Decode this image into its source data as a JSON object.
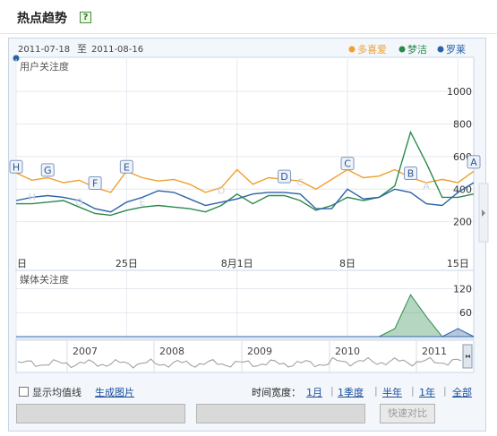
{
  "header": {
    "title": "热点趋势",
    "help_icon": "?"
  },
  "date_range": {
    "start": "2011-07-18",
    "sep": "至",
    "end": "2011-08-16"
  },
  "legend": [
    {
      "label": "多喜爱",
      "color": "#f0a030"
    },
    {
      "label": "梦洁",
      "color": "#2a8a4a"
    },
    {
      "label": "罗莱",
      "color": "#2a62a8"
    }
  ],
  "chart_data": [
    {
      "type": "line",
      "title": "用户关注度",
      "x_ticks": [
        "日",
        "25日",
        "8月1日",
        "8日",
        "15日"
      ],
      "ylim": [
        0,
        1100
      ],
      "y_ticks": [
        "200",
        "400",
        "600",
        "800",
        "1000"
      ],
      "x": [
        18,
        19,
        20,
        21,
        22,
        23,
        24,
        25,
        26,
        27,
        28,
        29,
        30,
        31,
        1,
        2,
        3,
        4,
        5,
        6,
        7,
        8,
        9,
        10,
        11,
        12,
        13,
        14,
        15,
        16
      ],
      "series": [
        {
          "name": "多喜爱",
          "color": "#f0a030",
          "values": [
            500,
            455,
            470,
            440,
            455,
            410,
            380,
            510,
            470,
            450,
            460,
            430,
            380,
            410,
            520,
            430,
            470,
            460,
            450,
            400,
            460,
            520,
            470,
            480,
            520,
            470,
            440,
            460,
            440,
            510
          ]
        },
        {
          "name": "梦洁",
          "color": "#2a8a4a",
          "values": [
            310,
            310,
            320,
            330,
            290,
            250,
            240,
            270,
            290,
            300,
            290,
            280,
            260,
            300,
            370,
            310,
            360,
            360,
            330,
            270,
            300,
            350,
            330,
            350,
            420,
            750,
            560,
            350,
            350,
            370
          ]
        },
        {
          "name": "罗莱",
          "color": "#2a62a8",
          "values": [
            330,
            350,
            360,
            350,
            330,
            280,
            260,
            320,
            350,
            390,
            380,
            340,
            300,
            320,
            340,
            370,
            380,
            380,
            370,
            280,
            280,
            400,
            340,
            350,
            400,
            380,
            310,
            300,
            380,
            440
          ]
        }
      ],
      "annotations": [
        "H",
        "G",
        "F",
        "E",
        "D",
        "C",
        "B",
        "A"
      ]
    },
    {
      "type": "area",
      "title": "媒体关注度",
      "ylim": [
        0,
        130
      ],
      "y_ticks": [
        "60",
        "120"
      ],
      "series": [
        {
          "name": "梦洁",
          "color": "#2a8a4a",
          "values": [
            0,
            0,
            0,
            0,
            0,
            0,
            0,
            0,
            0,
            0,
            0,
            0,
            0,
            0,
            0,
            0,
            0,
            0,
            0,
            0,
            0,
            0,
            0,
            0,
            20,
            105,
            50,
            0,
            0,
            0
          ]
        },
        {
          "name": "罗莱",
          "color": "#2a62a8",
          "values": [
            0,
            0,
            0,
            0,
            0,
            0,
            0,
            0,
            0,
            0,
            0,
            0,
            0,
            0,
            0,
            0,
            0,
            0,
            0,
            0,
            0,
            0,
            0,
            0,
            0,
            0,
            0,
            0,
            20,
            0
          ]
        }
      ]
    }
  ],
  "overview": {
    "years": [
      "2007",
      "2008",
      "2009",
      "2010",
      "2011"
    ]
  },
  "controls": {
    "show_avg": "显示均值线",
    "gen_image": "生成图片",
    "time_width_label": "时间宽度：",
    "ranges": [
      "1月",
      "1季度",
      "半年",
      "1年",
      "全部"
    ],
    "compare_button": "快速对比"
  }
}
